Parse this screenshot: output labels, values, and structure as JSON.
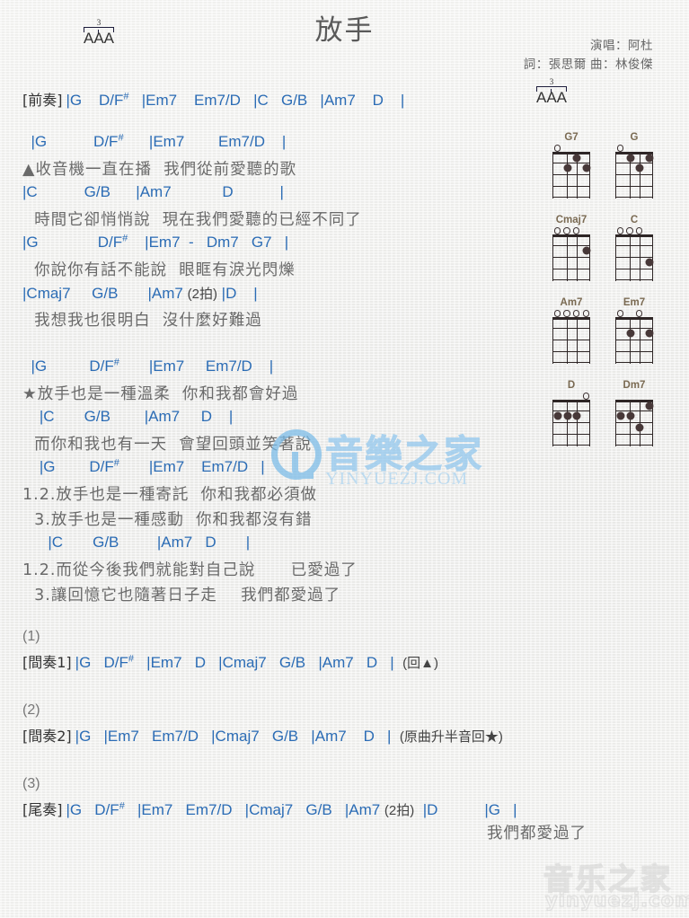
{
  "header": {
    "title": "放手",
    "singer_line": "演唱：阿杜",
    "writer_line": "詞：張思爾  曲：林俊傑"
  },
  "strum": {
    "triplet_number": "3",
    "letters": "AAA"
  },
  "intro": {
    "tag": "[前奏]",
    "chords": "|G    D/F#   |Em7    Em7/D   |C   G/B   |Am7    D    |"
  },
  "verse": {
    "lines": [
      {
        "chords": "  |G           D/F#      |Em7        Em7/D    |",
        "lyric": "▲收音機一直在播  我們從前愛聽的歌"
      },
      {
        "chords": "|C           G/B      |Am7            D           |",
        "lyric": "  時間它卻悄悄說  現在我們愛聽的已經不同了"
      },
      {
        "chords": "|G              D/F#    |Em7  -   Dm7   G7   |",
        "lyric": "  你說你有話不能說  眼眶有淚光閃爍"
      },
      {
        "chords": "|Cmaj7     G/B       |Am7 (2拍) |D    |",
        "lyric": "  我想我也很明白  沒什麼好難過"
      }
    ]
  },
  "chorus": {
    "lines": [
      {
        "chords": "  |G          D/F#       |Em7     Em7/D    |",
        "lyric": "★放手也是一種溫柔  你和我都會好過"
      },
      {
        "chords": "    |C       G/B        |Am7     D    |",
        "lyric": "  而你和我也有一天  會望回頭並笑著說"
      },
      {
        "chords": "    |G        D/F#       |Em7    Em7/D   |",
        "lyric_a": "1.2.放手也是一種寄託  你和我都必須做",
        "lyric_b": "  3.放手也是一種感動  你和我都沒有錯"
      },
      {
        "chords": "      |C       G/B         |Am7   D       |",
        "lyric_a": "1.2.而從今後我們就能對自己說      已愛過了",
        "lyric_b": "  3.讓回憶它也隨著日子走    我們都愛過了"
      }
    ]
  },
  "interlude1": {
    "marker": "(1)",
    "tag": "[間奏1]",
    "chords": "|G   D/F#   |Em7   D   |Cmaj7   G/B   |Am7   D   |  (回▲)"
  },
  "interlude2": {
    "marker": "(2)",
    "tag": "[間奏2]",
    "chords": "|G   |Em7   Em7/D   |Cmaj7   G/B   |Am7    D   |  (原曲升半音回★)"
  },
  "outro": {
    "marker": "(3)",
    "tag": "[尾奏]",
    "chords": "|G   D/F#   |Em7   Em7/D   |Cmaj7   G/B   |Am7 (2拍)  |D           |G   |",
    "lyric": "我們都愛過了"
  },
  "diagrams": [
    {
      "name": "G7",
      "opens": [
        1,
        0,
        0,
        0
      ],
      "dots": [
        {
          "string": 3,
          "fret": 1
        },
        {
          "string": 2,
          "fret": 2
        },
        {
          "string": 4,
          "fret": 2
        }
      ]
    },
    {
      "name": "G",
      "opens": [
        1,
        0,
        0,
        0
      ],
      "dots": [
        {
          "string": 2,
          "fret": 1
        },
        {
          "string": 4,
          "fret": 1
        },
        {
          "string": 3,
          "fret": 2
        }
      ]
    },
    {
      "name": "Cmaj7",
      "opens": [
        1,
        1,
        1,
        0
      ],
      "dots": [
        {
          "string": 4,
          "fret": 2
        }
      ]
    },
    {
      "name": "C",
      "opens": [
        1,
        1,
        1,
        0
      ],
      "dots": [
        {
          "string": 4,
          "fret": 3
        }
      ]
    },
    {
      "name": "Am7",
      "opens": [
        1,
        1,
        1,
        1
      ],
      "dots": []
    },
    {
      "name": "Em7",
      "opens": [
        1,
        0,
        1,
        0
      ],
      "dots": [
        {
          "string": 2,
          "fret": 2
        },
        {
          "string": 4,
          "fret": 2
        }
      ]
    },
    {
      "name": "D",
      "opens": [
        0,
        0,
        0,
        1
      ],
      "dots": [
        {
          "string": 1,
          "fret": 2
        },
        {
          "string": 2,
          "fret": 2
        },
        {
          "string": 3,
          "fret": 2
        }
      ]
    },
    {
      "name": "Dm7",
      "opens": [
        0,
        0,
        0,
        0
      ],
      "dots": [
        {
          "string": 4,
          "fret": 1
        },
        {
          "string": 1,
          "fret": 2
        },
        {
          "string": 2,
          "fret": 2
        },
        {
          "string": 3,
          "fret": 3
        }
      ]
    }
  ],
  "watermarks": {
    "center_cn": "音樂之家",
    "center_en": "YINYUEZJ.COM",
    "corner_cn": "音乐之家",
    "corner_en": "yinyuezj.com"
  }
}
